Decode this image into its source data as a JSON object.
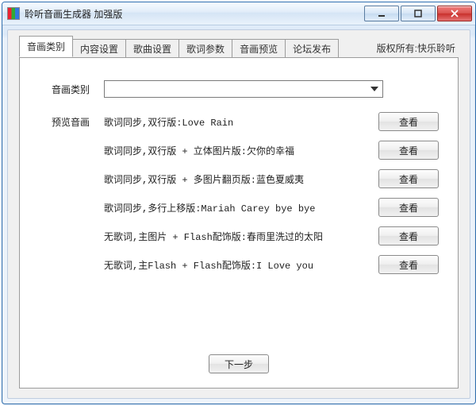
{
  "window": {
    "title": "聆听音画生成器 加强版"
  },
  "tabs": [
    "音画类别",
    "内容设置",
    "歌曲设置",
    "歌词参数",
    "音画预览",
    "论坛发布"
  ],
  "active_tab_index": 0,
  "copyright": "版权所有:快乐聆听",
  "labels": {
    "category": "音画类别",
    "preview": "预览音画"
  },
  "category_select": {
    "value": ""
  },
  "preview_items": [
    "歌词同步,双行版:Love Rain",
    "歌词同步,双行版 + 立体图片版:欠你的幸福",
    "歌词同步,双行版 + 多图片翻页版:蓝色夏威夷",
    "歌词同步,多行上移版:Mariah Carey bye bye",
    "无歌词,主图片 + Flash配饰版:春雨里洗过的太阳",
    "无歌词,主Flash + Flash配饰版:I Love you"
  ],
  "buttons": {
    "view": "查看",
    "next": "下一步"
  }
}
